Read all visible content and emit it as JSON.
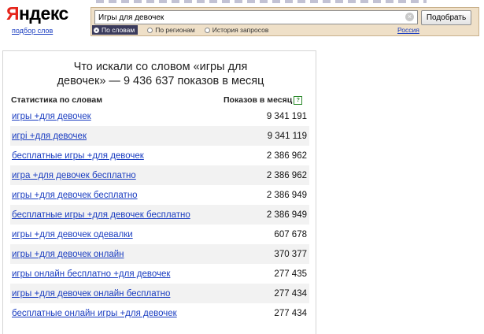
{
  "header": {
    "logo_first": "Я",
    "logo_rest": "ндекс",
    "logo_sub": "подбор слов",
    "search_value": "Игры для девочек",
    "clear_icon": "×",
    "search_button": "Подобрать",
    "radio_options": [
      {
        "label": "По словам",
        "selected": true
      },
      {
        "label": "По регионам",
        "selected": false
      },
      {
        "label": "История запросов",
        "selected": false
      }
    ],
    "region": "Россия"
  },
  "panel": {
    "title_line1": "Что искали со словом «игры для",
    "title_line2": "девочек» — 9 436 637 показов в месяц",
    "col_left": "Статистика по словам",
    "col_right": "Показов в месяц",
    "help_icon": "?"
  },
  "rows": [
    {
      "query": "игры +для девочек",
      "count": "9 341 191"
    },
    {
      "query": "игрi +для девочек",
      "count": "9 341 119"
    },
    {
      "query": "бесплатные игры +для девочек",
      "count": "2 386 962"
    },
    {
      "query": "игра +для девочек бесплатно",
      "count": "2 386 962"
    },
    {
      "query": "игры +для девочек бесплатно",
      "count": "2 386 949"
    },
    {
      "query": "бесплатные игры +для девочек бесплатно",
      "count": "2 386 949"
    },
    {
      "query": "игры +для девочек одевалки",
      "count": "607 678"
    },
    {
      "query": "игры +для девочек онлайн",
      "count": "370 377"
    },
    {
      "query": "игры онлайн бесплатно +для девочек",
      "count": "277 435"
    },
    {
      "query": "игры +для девочек онлайн бесплатно",
      "count": "277 434"
    },
    {
      "query": "бесплатные онлайн игры +для девочек",
      "count": "277 434"
    }
  ]
}
